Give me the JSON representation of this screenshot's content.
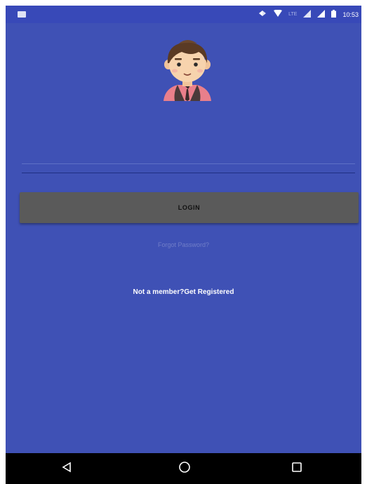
{
  "status_bar": {
    "network_label": "LTE",
    "time": "10:53",
    "icons": [
      "notification-icon",
      "data-sync-icon",
      "wifi-icon",
      "signal-icon",
      "signal-icon",
      "battery-icon"
    ]
  },
  "login_form": {
    "username_placeholder": "",
    "password_placeholder": "",
    "login_button_label": "LOGIN",
    "forgot_password_text": "Forgot Password?",
    "register_text": "Not a member?Get Registered"
  },
  "nav_bar": {
    "icons": [
      "back-icon",
      "home-icon",
      "recents-icon"
    ]
  },
  "colors": {
    "background": "#3f51b5",
    "status_bar": "#3849b8",
    "button": "#5a5a5a",
    "nav_bar": "#000000"
  }
}
